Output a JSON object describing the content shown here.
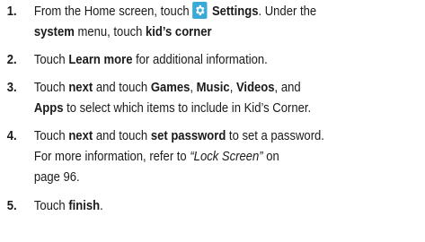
{
  "steps": [
    {
      "number": "1.",
      "text": {
        "part1": "From the Home screen, touch ",
        "settings": "Settings",
        "part2": ". Under the",
        "system": "system",
        "part3": " menu, touch ",
        "kids_corner": "kid’s corner"
      },
      "icon": "settings-gear-icon"
    },
    {
      "number": "2.",
      "text": {
        "part1": "Touch ",
        "learn_more": "Learn more",
        "part2": " for additional information."
      }
    },
    {
      "number": "3.",
      "text": {
        "part1": "Touch ",
        "next": "next",
        "part2": " and touch ",
        "games": "Games",
        "sep1": ", ",
        "music": "Music",
        "sep2": ", ",
        "videos": "Videos",
        "part3": ", and",
        "apps": "Apps",
        "part4": " to select which items to include in Kid’s Corner."
      }
    },
    {
      "number": "4.",
      "text": {
        "part1": "Touch ",
        "next": "next",
        "part2": " and touch ",
        "set_password": "set password",
        "part3": " to set a password.",
        "line2": "For more information, refer to ",
        "ref": "“Lock Screen”",
        "part4": " on",
        "line3": "page 96."
      }
    },
    {
      "number": "5.",
      "text": {
        "part1": "Touch ",
        "finish": "finish",
        "part2": "."
      }
    }
  ],
  "colors": {
    "icon_bg": "#3aa9d6",
    "text": "#1a1a1a"
  }
}
